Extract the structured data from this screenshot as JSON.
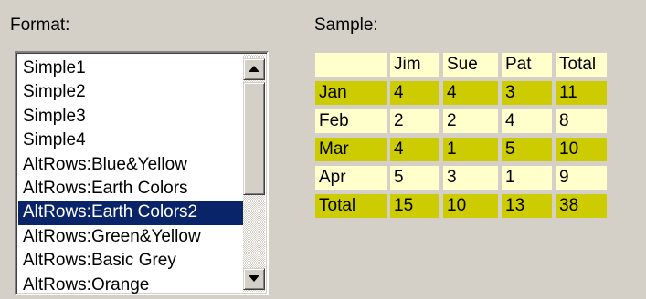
{
  "format_label": "Format:",
  "sample_label": "Sample:",
  "formats": [
    "Simple1",
    "Simple2",
    "Simple3",
    "Simple4",
    "AltRows:Blue&Yellow",
    "AltRows:Earth Colors",
    "AltRows:Earth Colors2",
    "AltRows:Green&Yellow",
    "AltRows:Basic Grey",
    "AltRows:Orange"
  ],
  "selected_format": "AltRows:Earth Colors2",
  "sample": {
    "header": [
      "",
      "Jim",
      "Sue",
      "Pat",
      "Total"
    ],
    "rows": [
      [
        "Jan",
        "4",
        "4",
        "3",
        "11"
      ],
      [
        "Feb",
        "2",
        "2",
        "4",
        "8"
      ],
      [
        "Mar",
        "4",
        "1",
        "5",
        "10"
      ],
      [
        "Apr",
        "5",
        "3",
        "1",
        "9"
      ],
      [
        "Total",
        "15",
        "10",
        "13",
        "38"
      ]
    ]
  },
  "colors": {
    "light_row": "#ffffcc",
    "dark_row": "#cccc00",
    "selection": "#0a246a"
  },
  "icons": {
    "scroll_up": "up-arrow-icon",
    "scroll_down": "down-arrow-icon"
  }
}
